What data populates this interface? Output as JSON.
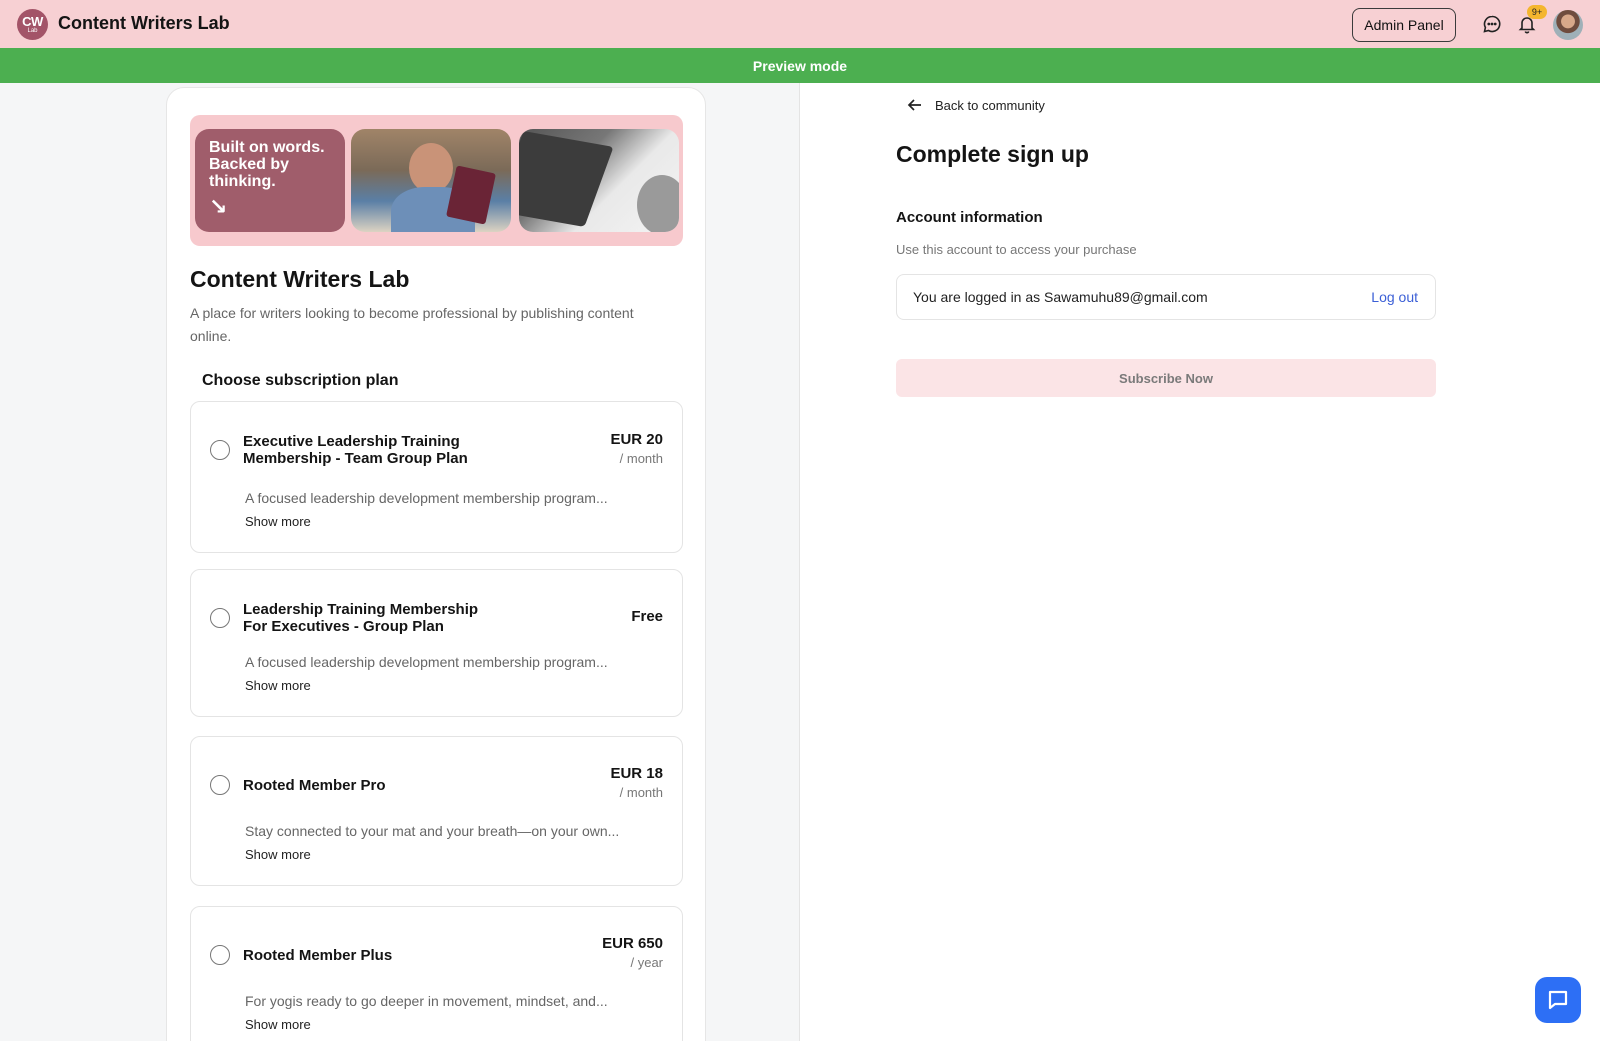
{
  "header": {
    "logo_text": "CW",
    "logo_subtext": "Lab",
    "brand": "Content Writers Lab",
    "admin_label": "Admin Panel",
    "notification_badge": "9+"
  },
  "preview": {
    "label": "Preview mode"
  },
  "community": {
    "banner_text": "Built on words. Backed by thinking.",
    "banner_arrow": "↘",
    "title": "Content Writers Lab",
    "description": "A place for writers looking to become professional by publishing content online.",
    "choose_label": "Choose subscription plan"
  },
  "plans": [
    {
      "name": "Executive Leadership Training Membership - Team Group Plan",
      "price": "EUR 20",
      "period": "/ month",
      "desc": "A focused leadership development membership program...",
      "more": "Show more"
    },
    {
      "name": "Leadership Training Membership For Executives - Group Plan",
      "price": "Free",
      "period": "",
      "desc": "A focused leadership development membership program...",
      "more": "Show more"
    },
    {
      "name": "Rooted Member Pro",
      "price": "EUR 18",
      "period": "/ month",
      "desc": "Stay connected to your mat and your breath—on your own...",
      "more": "Show more"
    },
    {
      "name": "Rooted Member Plus",
      "price": "EUR 650",
      "period": "/ year",
      "desc": "For yogis ready to go deeper in movement, mindset, and...",
      "more": "Show more"
    }
  ],
  "signup": {
    "back_label": "Back to community",
    "title": "Complete sign up",
    "section_title": "Account information",
    "section_sub": "Use this account to access your purchase",
    "logged_in_text": "You are logged in as Sawamuhu89@gmail.com",
    "logout_label": "Log out",
    "subscribe_label": "Subscribe Now"
  },
  "colors": {
    "topbar": "#f7d0d3",
    "preview": "#4caf50",
    "brand_accent": "#a35468",
    "link": "#3b5fd6",
    "chat_fab": "#2d6ff5"
  }
}
